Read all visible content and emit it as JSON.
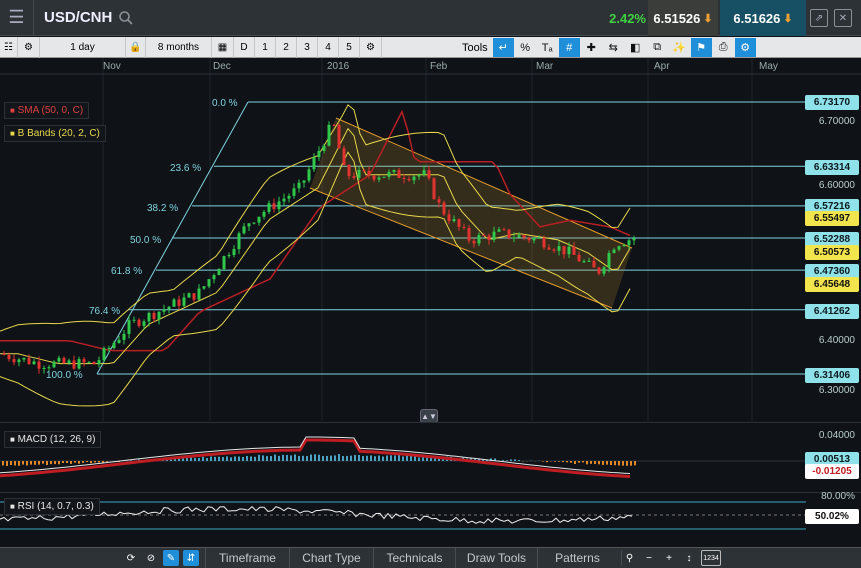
{
  "header": {
    "symbol": "USD/CNH",
    "change_pct": "2.42%",
    "sell_price": "6.51526",
    "buy_price": "6.51626"
  },
  "toolbar": {
    "interval": "1 day",
    "range": "8 months",
    "period_buttons": [
      "D",
      "1",
      "2",
      "3",
      "4",
      "5"
    ],
    "tools_label": "Tools"
  },
  "xaxis": {
    "labels": [
      "Nov",
      "Dec",
      "2016",
      "Feb",
      "Mar",
      "Apr",
      "May"
    ]
  },
  "legends": {
    "sma": "SMA (50, 0, C)",
    "bbands": "B Bands (20, 2, C)",
    "macd": "MACD (12, 26, 9)",
    "rsi": "RSI (14, 0.7, 0.3)"
  },
  "fib_labels": [
    "0.0 %",
    "23.6 %",
    "38.2 %",
    "50.0 %",
    "61.8 %",
    "76.4 %",
    "100.0 %"
  ],
  "price_axis": {
    "ticks": [
      "6.70000",
      "6.60000",
      "6.40000",
      "6.30000"
    ],
    "flags": [
      {
        "label": "6.73170",
        "style": "cyan"
      },
      {
        "label": "6.63314",
        "style": "cyan"
      },
      {
        "label": "6.57216",
        "style": "cyan"
      },
      {
        "label": "6.55497",
        "style": "yellow"
      },
      {
        "label": "6.52288",
        "style": "cyan"
      },
      {
        "label": "6.50573",
        "style": "yellow"
      },
      {
        "label": "6.47360",
        "style": "cyan"
      },
      {
        "label": "6.45648",
        "style": "yellow"
      },
      {
        "label": "6.41262",
        "style": "cyan"
      },
      {
        "label": "6.31406",
        "style": "cyan"
      }
    ]
  },
  "macd_axis": {
    "tick": "0.04000",
    "flag_a": "0.00513",
    "flag_b": "-0.01205"
  },
  "rsi_axis": {
    "tick": "80.00%",
    "flag": "50.02%"
  },
  "bottom_tabs": [
    "Timeframe",
    "Chart Type",
    "Technicals",
    "Draw Tools",
    "Patterns"
  ],
  "bottom_badge": "1234",
  "colors": {
    "sma": "#b81f24",
    "bbands": "#e8d84a",
    "fib": "#7fd3e0",
    "up": "#2fc84a",
    "down": "#e0322f",
    "accent": "#1e8fd8"
  },
  "chart_data": {
    "type": "candlestick",
    "series_names": [
      "SMA (50, 0, C)",
      "B Bands (20, 2, C)"
    ],
    "fibonacci": {
      "high": 6.7317,
      "low": 6.31406,
      "levels": [
        {
          "pct": "0.0 %",
          "price": 6.7317
        },
        {
          "pct": "23.6 %",
          "price": 6.63314
        },
        {
          "pct": "38.2 %",
          "price": 6.57216
        },
        {
          "pct": "50.0 %",
          "price": 6.52288
        },
        {
          "pct": "61.8 %",
          "price": 6.4736
        },
        {
          "pct": "76.4 %",
          "price": 6.41262
        },
        {
          "pct": "100.0 %",
          "price": 6.31406
        }
      ]
    },
    "last": {
      "sma": 6.55497,
      "bb_mid": 6.50573,
      "bb_lower": 6.45648
    },
    "ylim": [
      6.3,
      6.75
    ],
    "x_labels": [
      "Nov",
      "Dec",
      "2016",
      "Feb",
      "Mar",
      "Apr",
      "May"
    ],
    "macd": {
      "line": 0.00513,
      "signal": -0.01205
    },
    "rsi": {
      "value": 50.02,
      "upper": 80.0
    }
  }
}
